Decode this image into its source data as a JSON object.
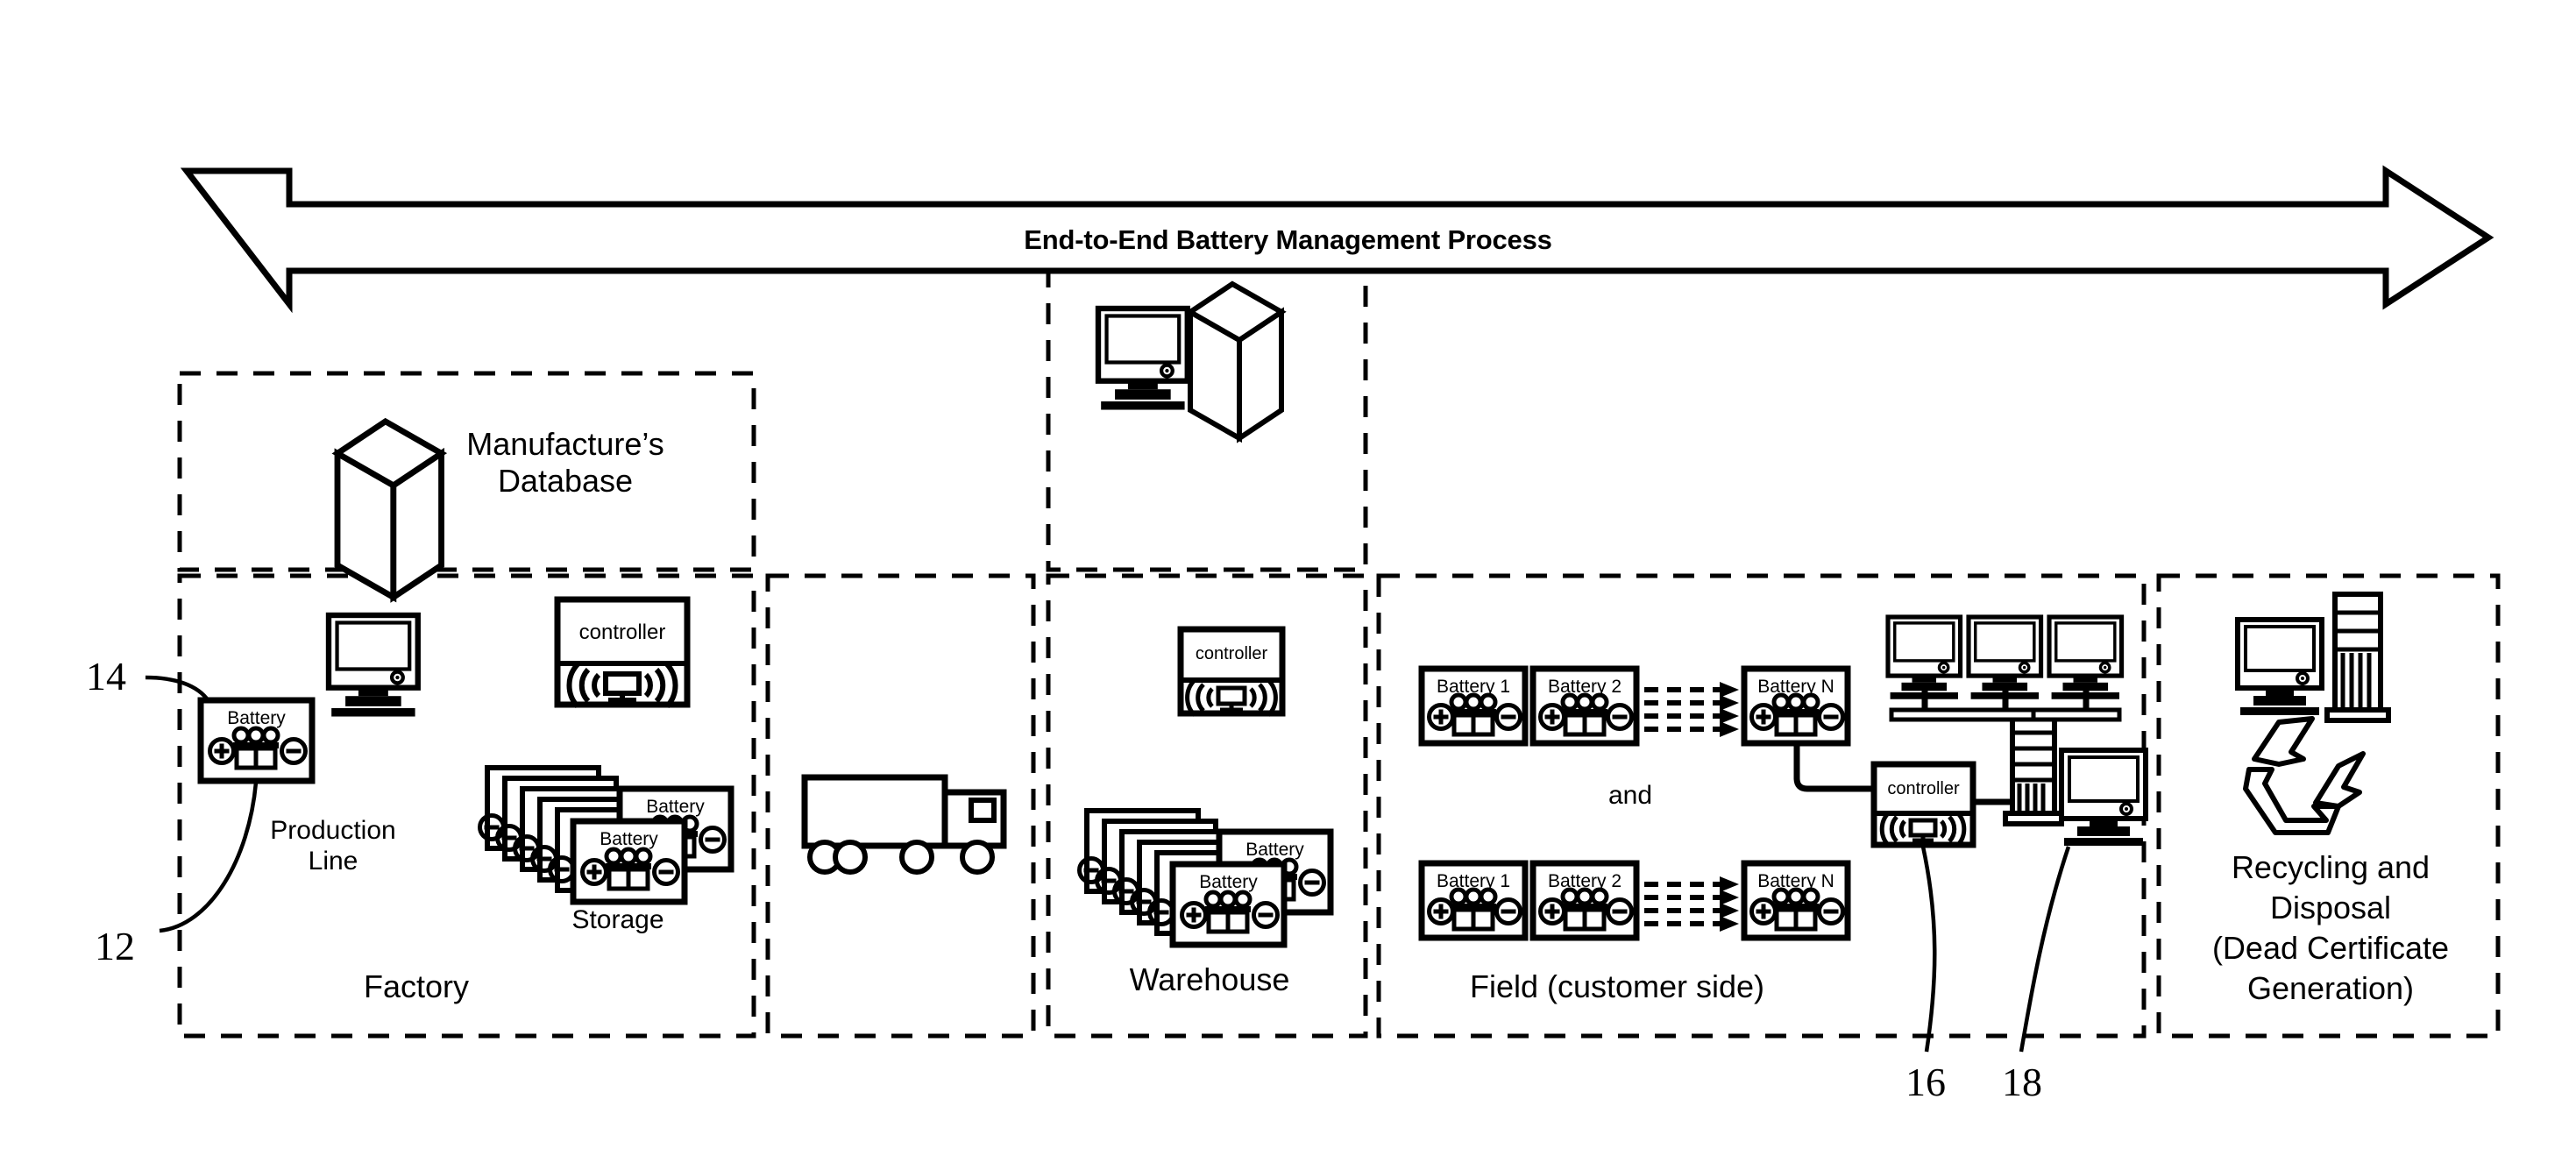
{
  "figure": {
    "banner": {
      "title": "End-to-End Battery Management Process",
      "icon": "double-headed-arrow"
    },
    "sections": [
      {
        "id": "manufacturers-database",
        "label": "Manufacture’s\nDatabase",
        "icons": [
          "server-tower-icon"
        ]
      },
      {
        "id": "factory",
        "label": "Factory",
        "sub_labels": [
          "Production\nLine",
          "Storage"
        ],
        "icons": [
          "monitor-icon",
          "controller-icon",
          "battery-icon",
          "battery-stack-icon"
        ],
        "controller_label": "controller",
        "battery_label": "Battery"
      },
      {
        "id": "transport",
        "label": "",
        "icons": [
          "truck-icon"
        ]
      },
      {
        "id": "warehouse-top",
        "label": "",
        "icons": [
          "monitor-icon",
          "server-tower-icon"
        ]
      },
      {
        "id": "warehouse",
        "label": "Warehouse",
        "icons": [
          "controller-icon",
          "battery-stack-icon"
        ],
        "controller_label": "controller",
        "battery_label": "Battery"
      },
      {
        "id": "field",
        "label": "Field (customer side)",
        "conjunction": "and",
        "icons": [
          "battery-icon",
          "controller-icon",
          "server-rack-icon",
          "monitor-icon"
        ],
        "controller_label": "controller",
        "battery_rows": [
          [
            "Battery 1",
            "Battery 2",
            "Battery N"
          ],
          [
            "Battery 1",
            "Battery 2",
            "Battery N"
          ]
        ]
      },
      {
        "id": "recycling",
        "label": "Recycling and\nDisposal\n(Dead Certificate\nGeneration)",
        "icons": [
          "monitor-icon",
          "server-tower-icon",
          "recycle-icon"
        ]
      }
    ],
    "reference_numerals": [
      {
        "id": "ref-14",
        "value": "14",
        "points_to": "battery-icon-production-line"
      },
      {
        "id": "ref-12",
        "value": "12",
        "points_to": "production-line-battery"
      },
      {
        "id": "ref-16",
        "value": "16",
        "points_to": "field-controller"
      },
      {
        "id": "ref-18",
        "value": "18",
        "points_to": "field-monitor"
      }
    ],
    "colors": {
      "stroke": "#000000",
      "background": "#ffffff"
    }
  }
}
